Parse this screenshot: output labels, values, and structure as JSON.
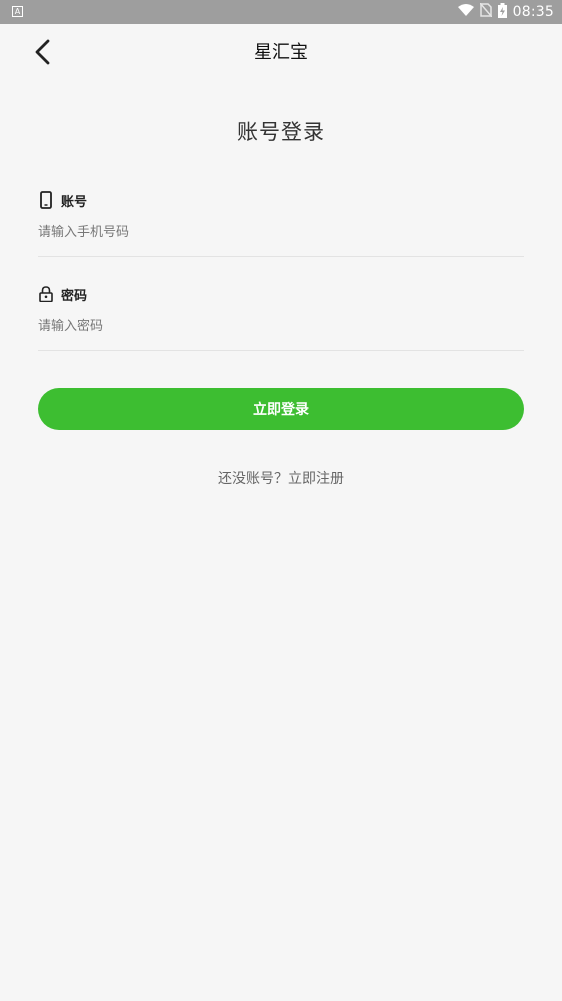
{
  "status_bar": {
    "left_badge": "A",
    "time": "08:35"
  },
  "header": {
    "title": "星汇宝"
  },
  "page": {
    "heading": "账号登录"
  },
  "account_field": {
    "label": "账号",
    "placeholder": "请输入手机号码",
    "value": ""
  },
  "password_field": {
    "label": "密码",
    "placeholder": "请输入密码",
    "value": ""
  },
  "login_button": {
    "label": "立即登录"
  },
  "register_link": {
    "text": "还没账号？立即注册"
  },
  "colors": {
    "accent": "#3dbe31",
    "background": "#f6f6f6",
    "status_bar": "#9e9e9e"
  }
}
